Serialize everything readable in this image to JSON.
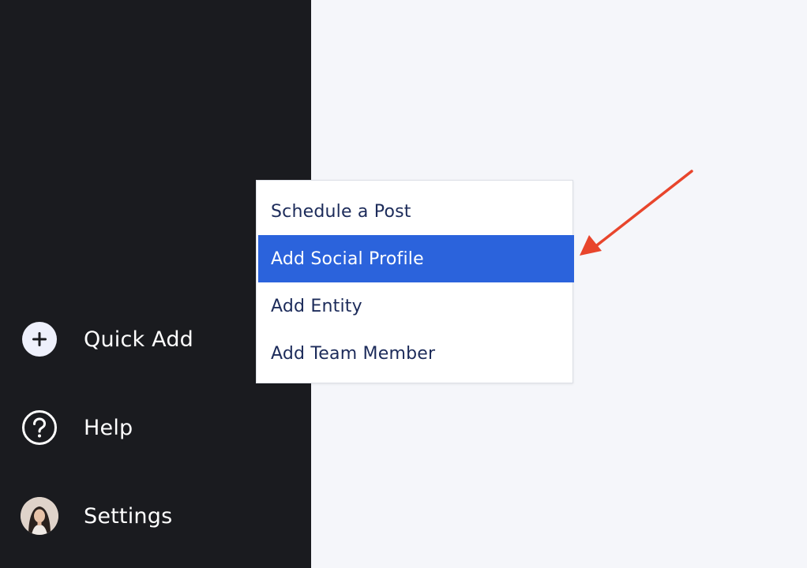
{
  "sidebar": {
    "items": [
      {
        "label": "Quick Add",
        "icon": "plus-circle-icon"
      },
      {
        "label": "Help",
        "icon": "question-circle-icon"
      },
      {
        "label": "Settings",
        "icon": "avatar"
      }
    ]
  },
  "dropdown": {
    "items": [
      {
        "label": "Schedule a Post",
        "active": false
      },
      {
        "label": "Add Social Profile",
        "active": true
      },
      {
        "label": "Add Entity",
        "active": false
      },
      {
        "label": "Add Team Member",
        "active": false
      }
    ]
  },
  "colors": {
    "sidebar_bg": "#1a1b1f",
    "main_bg": "#f5f6fa",
    "menu_text": "#1c2b5a",
    "highlight": "#2b63dc",
    "annotation_arrow": "#e8452c"
  }
}
